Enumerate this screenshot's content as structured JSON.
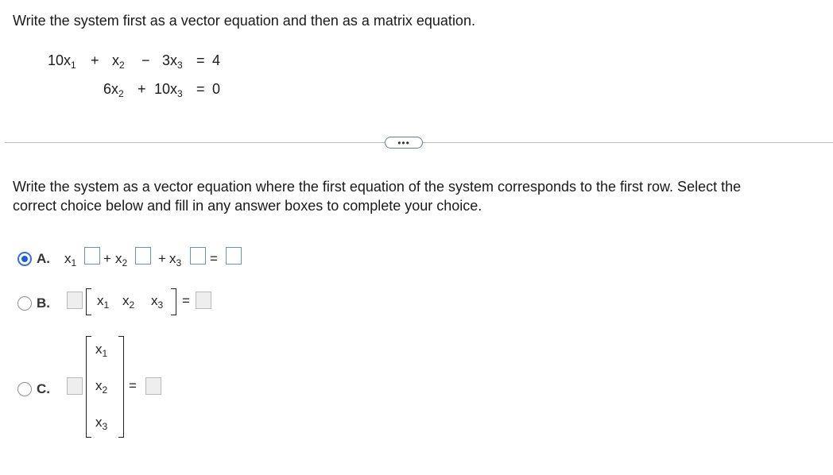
{
  "question": {
    "prompt": "Write the system first as a vector equation and then as a matrix equation."
  },
  "system": {
    "row1": {
      "c1": "10x",
      "s1": "1",
      "op1": "+",
      "c2": "x",
      "s2": "2",
      "op2": "−",
      "c3": "3x",
      "s3": "3",
      "eq": "=",
      "rhs": "4"
    },
    "row2": {
      "c2": "6x",
      "s2": "2",
      "op2": "+",
      "c3": "10x",
      "s3": "3",
      "eq": "=",
      "rhs": "0"
    }
  },
  "more_button": {
    "label": "•••"
  },
  "instruction": {
    "line1": "Write the system as a vector equation where the first equation of the system corresponds to the first row. Select the",
    "line2": "correct choice below and fill in any answer boxes to complete your choice."
  },
  "choices": {
    "a": {
      "letter": "A.",
      "selected": true,
      "v1": "x",
      "s1": "1",
      "plus1": "+",
      "v2": "x",
      "s2": "2",
      "plus2": "+",
      "v3": "x",
      "s3": "3",
      "eq": "="
    },
    "b": {
      "letter": "B.",
      "selected": false,
      "v1": "x",
      "s1": "1",
      "v2": "x",
      "s2": "2",
      "v3": "x",
      "s3": "3",
      "eq": "="
    },
    "c": {
      "letter": "C.",
      "selected": false,
      "v1": "x",
      "s1": "1",
      "v2": "x",
      "s2": "2",
      "v3": "x",
      "s3": "3",
      "eq": "="
    }
  },
  "colors": {
    "accent": "#1f5fd6",
    "box_border": "#6d8fbf",
    "disabled_box": "#eeeeee",
    "divider": "#b9b9b9"
  }
}
